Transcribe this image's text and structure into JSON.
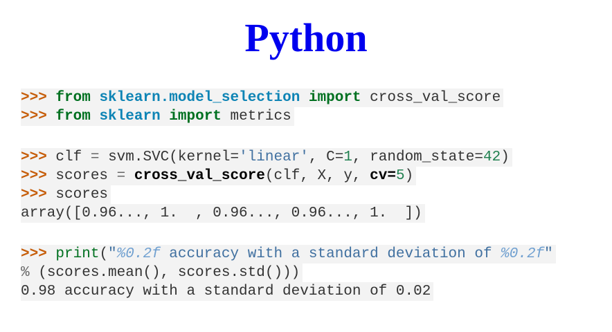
{
  "title": "Python",
  "prompt": ">>>",
  "code": {
    "l1": {
      "kw1": "from",
      "mod1": "sklearn.model_selection",
      "kw2": "import",
      "name": "cross_val_score"
    },
    "l2": {
      "kw1": "from",
      "mod1": "sklearn",
      "kw2": "import",
      "name": "metrics"
    },
    "l3": {
      "a": "clf",
      "eq": "=",
      "b": "svm.SVC(kernel=",
      "str": "'linear'",
      "c": ", C=",
      "n1": "1",
      "d": ", random_state=",
      "n2": "42",
      "e": ")"
    },
    "l4": {
      "a": "scores",
      "eq": "=",
      "fn": "cross_val_score",
      "args": "(clf, X, y, ",
      "kw": "cv=",
      "num": "5",
      "close": ")"
    },
    "l5": {
      "a": "scores"
    },
    "l6": {
      "out": "array([0.96..., 1.  , 0.96..., 0.96..., 1.  ])"
    },
    "l7": {
      "fn": "print",
      "paren": "(",
      "q1": "\"",
      "f1": "%0.2f",
      "mid": " accuracy with a standard deviation of ",
      "f2": "%0.2f",
      "q2": "\""
    },
    "l8": {
      "op": "%",
      "rest": "(scores.mean(), scores.std()))"
    },
    "l9": {
      "out": "0.98 accuracy with a standard deviation of 0.02"
    }
  }
}
